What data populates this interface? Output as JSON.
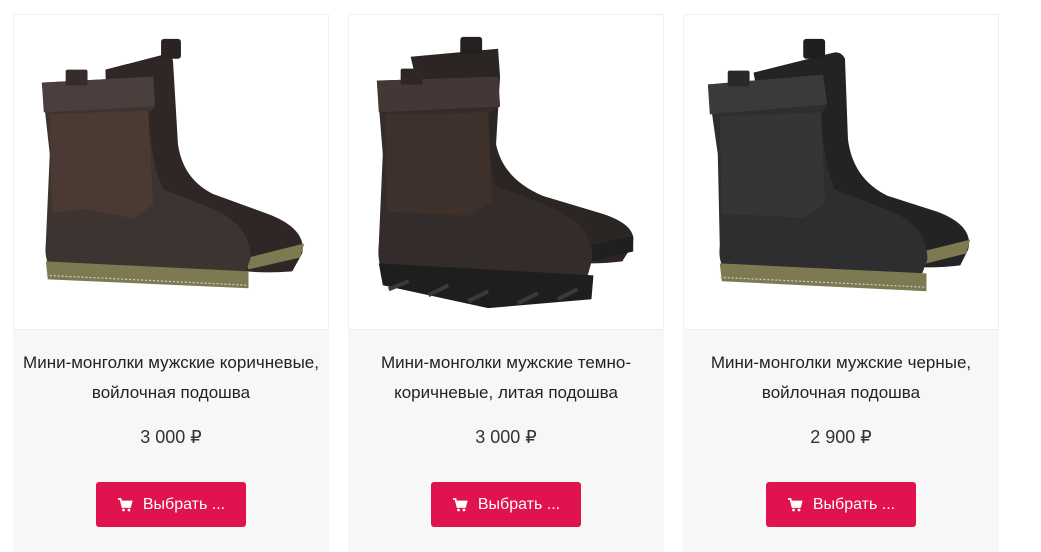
{
  "products": [
    {
      "title": "Мини-монголки мужские коричневые, войлочная подошва",
      "title_line1": "Мини-монголки мужские коричневые,",
      "title_line2": "войлочная подошва",
      "price": "3 000 ₽",
      "button_label": "Выбрать ...",
      "image_variant": "brown-felt-sole"
    },
    {
      "title": "Мини-монголки мужские темно-коричневые, литая подошва",
      "title_line1": "Мини-монголки мужские темно-",
      "title_line2": "коричневые, литая подошва",
      "price": "3 000 ₽",
      "button_label": "Выбрать ...",
      "image_variant": "dark-brown-cast-sole"
    },
    {
      "title": "Мини-монголки мужские черные, войлочная подошва",
      "title_line1": "Мини-монголки мужские черные,",
      "title_line2": "войлочная подошва",
      "price": "2 900 ₽",
      "button_label": "Выбрать ...",
      "image_variant": "black-felt-sole"
    }
  ],
  "colors": {
    "button_bg": "#e1134f",
    "card_bg": "#f7f7f7",
    "brown_leather": "#3d3431",
    "dark_brown_leather": "#332c2a",
    "black_leather": "#2e2e30",
    "felt_sole": "#7d7a52"
  },
  "icons": {
    "button_icon": "cart-icon"
  }
}
